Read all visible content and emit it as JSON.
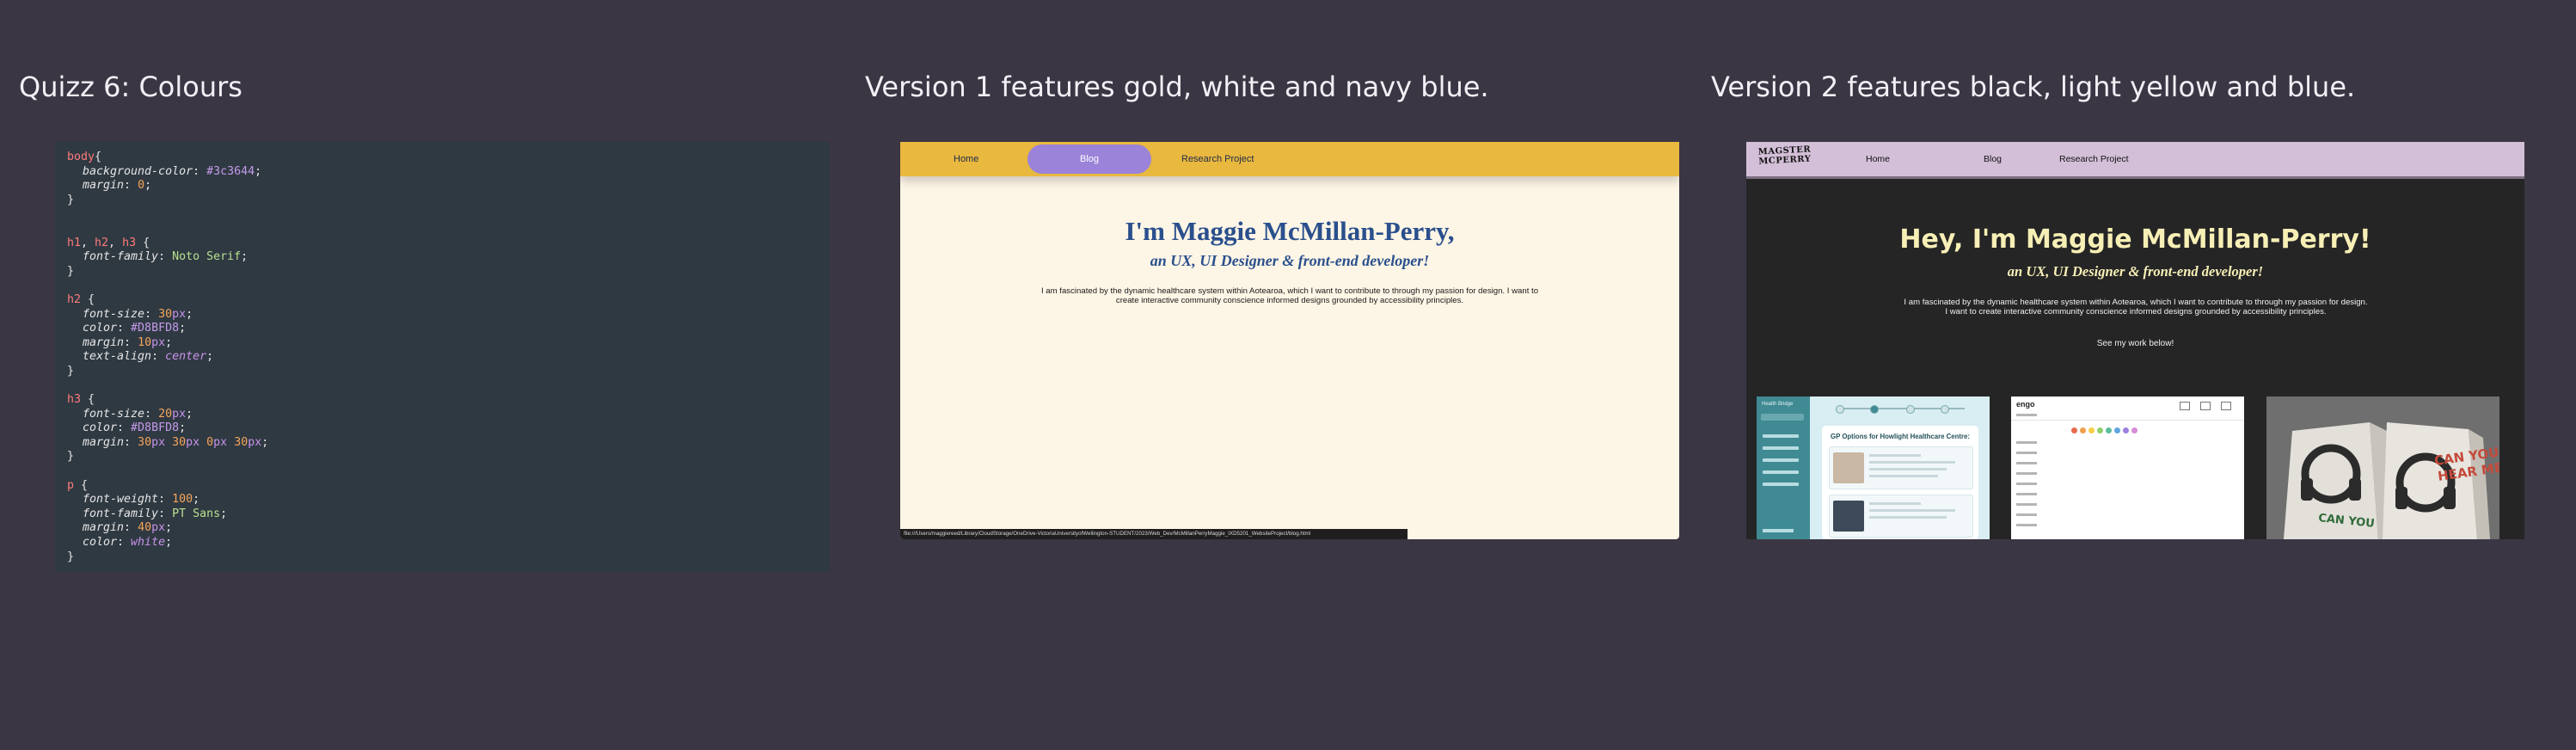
{
  "titles": {
    "quiz": "Quizz 6: Colours",
    "version1": "Version 1 features gold, white and navy blue.",
    "version2": "Version 2 features black, light yellow and blue."
  },
  "code": {
    "lines": [
      {
        "indent": false,
        "parts": [
          {
            "t": "body",
            "c": "sel"
          },
          {
            "t": "{",
            "c": ""
          }
        ]
      },
      {
        "indent": true,
        "parts": [
          {
            "t": "background-color",
            "c": "prop"
          },
          {
            "t": ": ",
            "c": ""
          },
          {
            "t": "#3c3644",
            "c": "hex"
          },
          {
            "t": ";",
            "c": ""
          }
        ]
      },
      {
        "indent": true,
        "parts": [
          {
            "t": "margin",
            "c": "prop"
          },
          {
            "t": ": ",
            "c": ""
          },
          {
            "t": "0",
            "c": "num"
          },
          {
            "t": ";",
            "c": ""
          }
        ]
      },
      {
        "indent": false,
        "parts": [
          {
            "t": "}",
            "c": ""
          }
        ]
      },
      {
        "indent": false,
        "parts": []
      },
      {
        "indent": false,
        "parts": []
      },
      {
        "indent": false,
        "parts": [
          {
            "t": "h1",
            "c": "sel"
          },
          {
            "t": ", ",
            "c": ""
          },
          {
            "t": "h2",
            "c": "sel"
          },
          {
            "t": ", ",
            "c": ""
          },
          {
            "t": "h3",
            "c": "sel"
          },
          {
            "t": " {",
            "c": ""
          }
        ]
      },
      {
        "indent": true,
        "parts": [
          {
            "t": "font-family",
            "c": "prop"
          },
          {
            "t": ": ",
            "c": ""
          },
          {
            "t": "Noto Serif",
            "c": "str"
          },
          {
            "t": ";",
            "c": ""
          }
        ]
      },
      {
        "indent": false,
        "parts": [
          {
            "t": "}",
            "c": ""
          }
        ]
      },
      {
        "indent": false,
        "parts": []
      },
      {
        "indent": false,
        "parts": [
          {
            "t": "h2",
            "c": "sel"
          },
          {
            "t": " {",
            "c": ""
          }
        ]
      },
      {
        "indent": true,
        "parts": [
          {
            "t": "font-size",
            "c": "prop"
          },
          {
            "t": ": ",
            "c": ""
          },
          {
            "t": "30",
            "c": "num"
          },
          {
            "t": "px",
            "c": "unit"
          },
          {
            "t": ";",
            "c": ""
          }
        ]
      },
      {
        "indent": true,
        "parts": [
          {
            "t": "color",
            "c": "prop"
          },
          {
            "t": ": ",
            "c": ""
          },
          {
            "t": "#D8BFD8",
            "c": "hex"
          },
          {
            "t": ";",
            "c": ""
          }
        ]
      },
      {
        "indent": true,
        "parts": [
          {
            "t": "margin",
            "c": "prop"
          },
          {
            "t": ": ",
            "c": ""
          },
          {
            "t": "10",
            "c": "num"
          },
          {
            "t": "px",
            "c": "unit"
          },
          {
            "t": ";",
            "c": ""
          }
        ]
      },
      {
        "indent": true,
        "parts": [
          {
            "t": "text-align",
            "c": "prop"
          },
          {
            "t": ": ",
            "c": ""
          },
          {
            "t": "center",
            "c": "kw"
          },
          {
            "t": ";",
            "c": ""
          }
        ]
      },
      {
        "indent": false,
        "parts": [
          {
            "t": "}",
            "c": ""
          }
        ]
      },
      {
        "indent": false,
        "parts": []
      },
      {
        "indent": false,
        "parts": [
          {
            "t": "h3",
            "c": "sel"
          },
          {
            "t": " {",
            "c": ""
          }
        ]
      },
      {
        "indent": true,
        "parts": [
          {
            "t": "font-size",
            "c": "prop"
          },
          {
            "t": ": ",
            "c": ""
          },
          {
            "t": "20",
            "c": "num"
          },
          {
            "t": "px",
            "c": "unit"
          },
          {
            "t": ";",
            "c": ""
          }
        ]
      },
      {
        "indent": true,
        "parts": [
          {
            "t": "color",
            "c": "prop"
          },
          {
            "t": ": ",
            "c": ""
          },
          {
            "t": "#D8BFD8",
            "c": "hex"
          },
          {
            "t": ";",
            "c": ""
          }
        ]
      },
      {
        "indent": true,
        "parts": [
          {
            "t": "margin",
            "c": "prop"
          },
          {
            "t": ": ",
            "c": ""
          },
          {
            "t": "30",
            "c": "num"
          },
          {
            "t": "px ",
            "c": "unit"
          },
          {
            "t": "30",
            "c": "num"
          },
          {
            "t": "px ",
            "c": "unit"
          },
          {
            "t": "0",
            "c": "num"
          },
          {
            "t": "px ",
            "c": "unit"
          },
          {
            "t": "30",
            "c": "num"
          },
          {
            "t": "px",
            "c": "unit"
          },
          {
            "t": ";",
            "c": ""
          }
        ]
      },
      {
        "indent": false,
        "parts": [
          {
            "t": "}",
            "c": ""
          }
        ]
      },
      {
        "indent": false,
        "parts": []
      },
      {
        "indent": false,
        "parts": [
          {
            "t": "p",
            "c": "sel"
          },
          {
            "t": " {",
            "c": ""
          }
        ]
      },
      {
        "indent": true,
        "parts": [
          {
            "t": "font-weight",
            "c": "prop"
          },
          {
            "t": ": ",
            "c": ""
          },
          {
            "t": "100",
            "c": "num"
          },
          {
            "t": ";",
            "c": ""
          }
        ]
      },
      {
        "indent": true,
        "parts": [
          {
            "t": "font-family",
            "c": "prop"
          },
          {
            "t": ": ",
            "c": ""
          },
          {
            "t": "PT Sans",
            "c": "str"
          },
          {
            "t": ";",
            "c": ""
          }
        ]
      },
      {
        "indent": true,
        "parts": [
          {
            "t": "margin",
            "c": "prop"
          },
          {
            "t": ": ",
            "c": ""
          },
          {
            "t": "40",
            "c": "num"
          },
          {
            "t": "px",
            "c": "unit"
          },
          {
            "t": ";",
            "c": ""
          }
        ]
      },
      {
        "indent": true,
        "parts": [
          {
            "t": "color",
            "c": "prop"
          },
          {
            "t": ": ",
            "c": ""
          },
          {
            "t": "white",
            "c": "kw"
          },
          {
            "t": ";",
            "c": ""
          }
        ]
      },
      {
        "indent": false,
        "parts": [
          {
            "t": "}",
            "c": ""
          }
        ]
      }
    ]
  },
  "version1": {
    "nav": {
      "home": "Home",
      "blog": "Blog",
      "research": "Research Project"
    },
    "heading": "I'm Maggie McMillan-Perry,",
    "subheading": "an UX, UI Designer & front-end developer!",
    "paragraph": "I am fascinated by the dynamic healthcare system within Aotearoa, which I want to contribute to through my passion for design. I want to create interactive community conscience informed designs grounded by accessibility principles.",
    "status_url": "file:///Users/maggiereed/Library/CloudStorage/OneDrive-VictoriaUniversityofWellington-STUDENT/2023/Web_Dev/McMillanPerryMaggie_IXD5201_WebsiteProject/blog.html",
    "colors": {
      "gold": "#e9b83f",
      "cream": "#fdf5e5",
      "navy": "#2a4f8d",
      "pill": "#9a83d8"
    }
  },
  "version2": {
    "logo": "MAGSTER MCPERRY",
    "nav": {
      "home": "Home",
      "blog": "Blog",
      "research": "Research Project"
    },
    "heading": "Hey, I'm Maggie McMillan-Perry!",
    "subheading": "an UX, UI Designer & front-end developer!",
    "paragraph": "I am fascinated by the dynamic healthcare system within Aotearoa, which I want to contribute to through my passion for design. I want to create interactive community conscience informed designs grounded by accessibility principles.",
    "cta": "See my work below!",
    "thumb1": {
      "app": "Health Bridge",
      "card_title": "GP Options for Howlight Healthcare Centre:"
    },
    "thumb2": {
      "logo": "engo"
    },
    "thumb3": {
      "line1": "CAN YOU",
      "line2": "HEAR ME?"
    },
    "colors": {
      "black": "#252526",
      "light_yellow": "#f7efb5",
      "lilac": "#d3bfd8"
    }
  }
}
